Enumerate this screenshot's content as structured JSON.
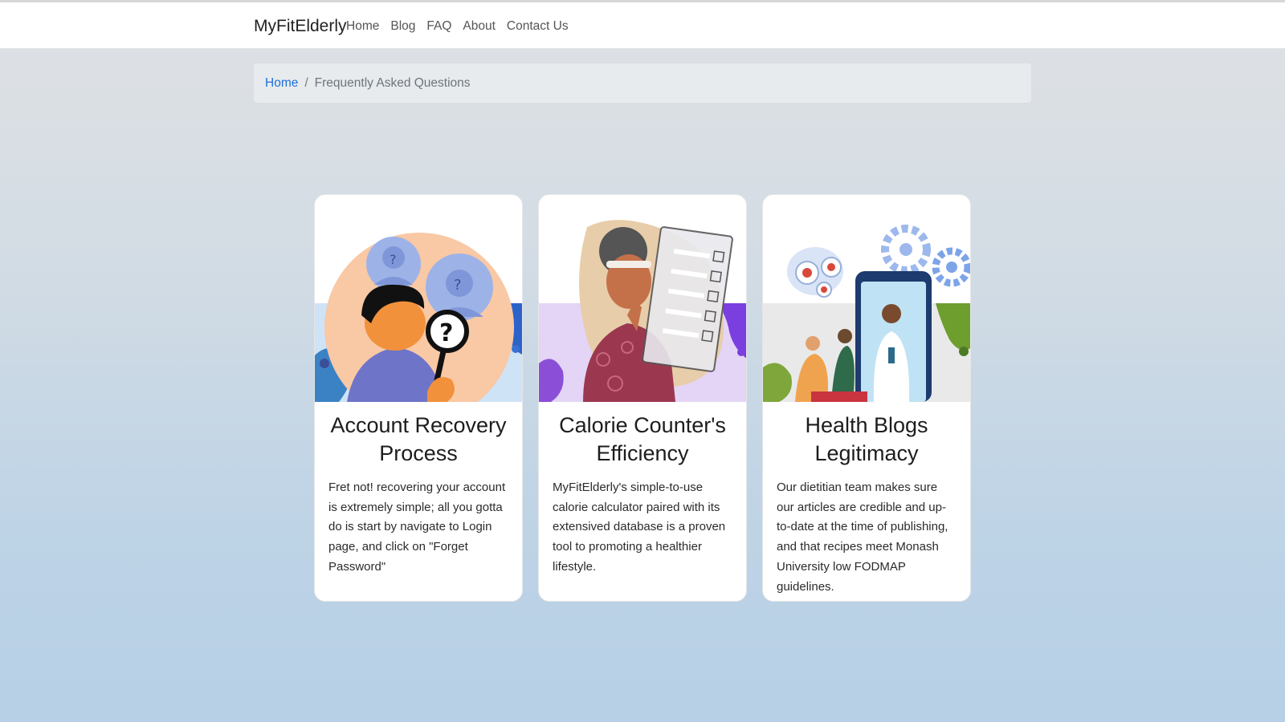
{
  "nav": {
    "brand": "MyFitElderly",
    "links": [
      "Home",
      "Blog",
      "FAQ",
      "About",
      "Contact Us"
    ]
  },
  "breadcrumb": {
    "home": "Home",
    "separator": "/",
    "current": "Frequently Asked Questions"
  },
  "cards": [
    {
      "title": "Account Recovery Process",
      "text": "Fret not! recovering your account is extremely simple; all you gotta do is start by navigate to Login page, and click on \"Forget Password\"",
      "image": "account-recovery-illustration"
    },
    {
      "title": "Calorie Counter's Efficiency",
      "text": "MyFitElderly's simple-to-use calorie calculator paired with its extensived database is a proven tool to promoting a healthier lifestyle.",
      "image": "calorie-checklist-illustration"
    },
    {
      "title": "Health Blogs Legitimacy",
      "text": "Our dietitian team makes sure our articles are credible and up-to-date at the time of publishing, and that recipes meet Monash University low FODMAP guidelines.",
      "image": "doctor-phone-illustration"
    }
  ],
  "colors": {
    "link": "#1e6fd9",
    "breadcrumb_bg": "#e8ebee",
    "card_bg": "#ffffff"
  }
}
